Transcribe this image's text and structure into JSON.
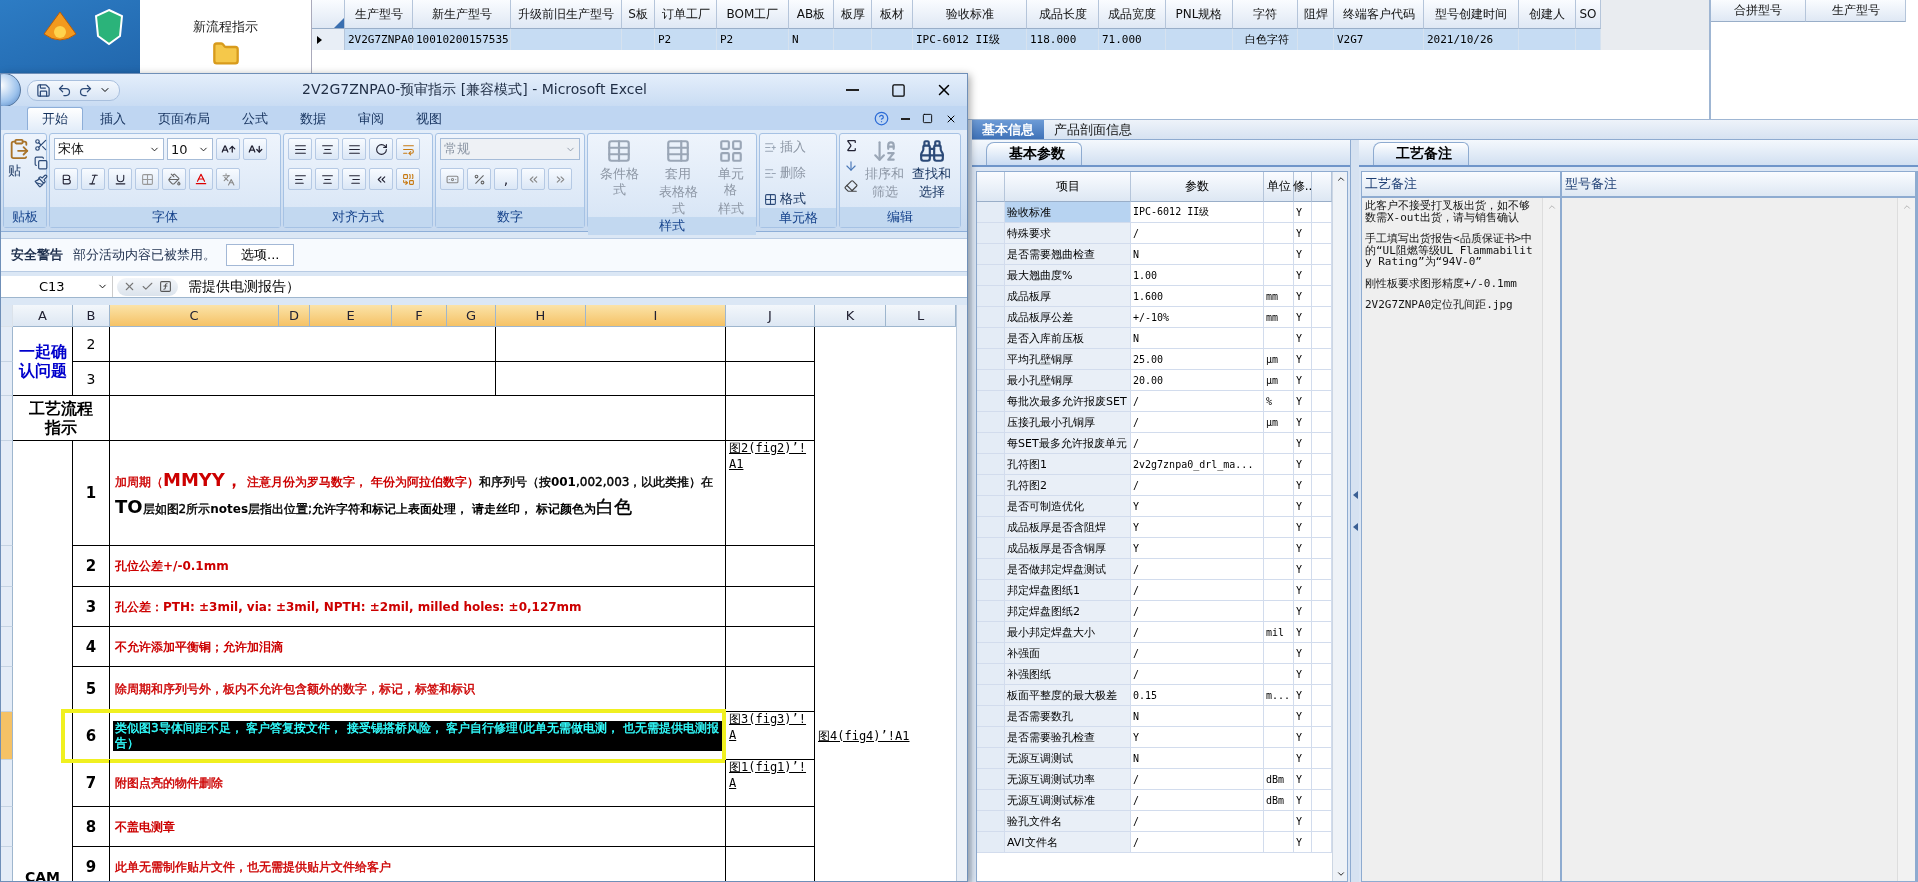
{
  "launcher": {
    "items": [
      {
        "label": "新流程指示"
      }
    ]
  },
  "order_grid": {
    "columns": [
      "生产型号",
      "新生产型号",
      "升级前旧生产型号",
      "S板",
      "订单工厂",
      "BOM工厂",
      "AB板",
      "板厚",
      "板材",
      "验收标准",
      "成品长度",
      "成品宽度",
      "PNL规格",
      "字符",
      "阻焊",
      "终端客户代码",
      "型号创建时间",
      "创建人",
      "SO"
    ],
    "rows": [
      {
        "selected": true,
        "cells": [
          "2V2G7ZNPA0",
          "10010200157535",
          "",
          "",
          "P2",
          "P2",
          "N",
          "",
          "",
          "IPC-6012 II级",
          "118.000",
          "71.000",
          "",
          "白色字符",
          "",
          "V2G7",
          "2021/10/26",
          "",
          ""
        ]
      }
    ]
  },
  "merge_grid": {
    "columns": [
      "合拼型号",
      "生产型号"
    ]
  },
  "info_tabs": [
    {
      "label": "基本信息",
      "selected": true
    },
    {
      "label": "产品剖面信息",
      "selected": false
    }
  ],
  "params": {
    "tab": "基本参数",
    "columns": [
      "项目",
      "参数",
      "单位",
      "修.."
    ],
    "rows": [
      {
        "item": "验收标准",
        "value": "IPC-6012 II级",
        "flag": "Y",
        "selected": true
      },
      {
        "item": "特殊要求",
        "value": "/",
        "flag": "Y",
        "selected": false
      },
      {
        "item": "是否需要翘曲检查",
        "value": "N",
        "flag": "Y",
        "selected": false
      },
      {
        "item": "最大翘曲度%",
        "value": "1.00",
        "flag": "Y",
        "selected": false
      },
      {
        "item": "成品板厚",
        "value": "1.600",
        "unit": "mm",
        "flag": "Y",
        "selected": false
      },
      {
        "item": "成品板厚公差",
        "value": "+/-10%",
        "unit": "mm",
        "flag": "Y",
        "selected": false
      },
      {
        "item": "是否入库前压板",
        "value": "N",
        "flag": "Y",
        "selected": false
      },
      {
        "item": "平均孔壁铜厚",
        "value": "25.00",
        "unit": "μm",
        "flag": "Y",
        "selected": false
      },
      {
        "item": "最小孔壁铜厚",
        "value": "20.00",
        "unit": "μm",
        "flag": "Y",
        "selected": false
      },
      {
        "item": "每批次最多允许报废SET",
        "value": "/",
        "unit": "%",
        "flag": "Y",
        "selected": false
      },
      {
        "item": "压接孔最小孔铜厚",
        "value": "/",
        "unit": "μm",
        "flag": "Y",
        "selected": false
      },
      {
        "item": "每SET最多允许报废单元",
        "value": "/",
        "flag": "Y",
        "selected": false
      },
      {
        "item": "孔符图1",
        "value": "2v2g7znpa0_drl_ma...",
        "flag": "Y",
        "selected": false
      },
      {
        "item": "孔符图2",
        "value": "/",
        "flag": "Y",
        "selected": false
      },
      {
        "item": "是否可制造优化",
        "value": "Y",
        "flag": "Y",
        "selected": false
      },
      {
        "item": "成品板厚是否含阻焊",
        "value": "Y",
        "flag": "Y",
        "selected": false
      },
      {
        "item": "成品板厚是否含铜厚",
        "value": "Y",
        "flag": "Y",
        "selected": false
      },
      {
        "item": "是否做邦定焊盘测试",
        "value": "/",
        "flag": "Y",
        "selected": false
      },
      {
        "item": "邦定焊盘图纸1",
        "value": "/",
        "flag": "Y",
        "selected": false
      },
      {
        "item": "邦定焊盘图纸2",
        "value": "/",
        "flag": "Y",
        "selected": false
      },
      {
        "item": "最小邦定焊盘大小",
        "value": "/",
        "unit": "mil",
        "flag": "Y",
        "selected": false
      },
      {
        "item": "补强面",
        "value": "/",
        "flag": "Y",
        "selected": false
      },
      {
        "item": "补强图纸",
        "value": "/",
        "flag": "Y",
        "selected": false
      },
      {
        "item": "板面平整度的最大极差",
        "value": "0.15",
        "unit": "m...",
        "flag": "Y",
        "selected": false
      },
      {
        "item": "是否需要数孔",
        "value": "N",
        "flag": "Y",
        "selected": false
      },
      {
        "item": "是否需要验孔检查",
        "value": "Y",
        "flag": "Y",
        "selected": false
      },
      {
        "item": "无源互调测试",
        "value": "N",
        "flag": "Y",
        "selected": false
      },
      {
        "item": "无源互调测试功率",
        "value": "/",
        "unit": "dBm",
        "flag": "Y",
        "selected": false
      },
      {
        "item": "无源互调测试标准",
        "value": "/",
        "unit": "dBm",
        "flag": "Y",
        "selected": false
      },
      {
        "item": "验孔文件名",
        "value": "/",
        "flag": "Y",
        "selected": false
      },
      {
        "item": "AVI文件名",
        "value": "/",
        "flag": "Y",
        "selected": false
      }
    ]
  },
  "notes": {
    "tab": "工艺备注",
    "columns": [
      "工艺备注",
      "型号备注"
    ],
    "process_notes": [
      "此客户不接受打叉板出货，如不够数需X-out出货，请与销售确认",
      "手工填写出货报告<品质保证书>中的“UL阻燃等级UL Flammability Rating”为“94V-0”",
      "刚性板要求图形精度+/-0.1mm",
      "2V2G7ZNPA0定位孔间距.jpg"
    ]
  },
  "excel": {
    "title": "2V2G7ZNPA0-预审指示  [兼容模式] - Microsoft Excel",
    "ribbon_tabs": [
      {
        "label": "开始",
        "selected": true
      },
      {
        "label": "插入",
        "selected": false
      },
      {
        "label": "页面布局",
        "selected": false
      },
      {
        "label": "公式",
        "selected": false
      },
      {
        "label": "数据",
        "selected": false
      },
      {
        "label": "审阅",
        "selected": false
      },
      {
        "label": "视图",
        "selected": false
      }
    ],
    "ribbon": {
      "paste_label": "贴",
      "font_name": "宋体",
      "font_size": "10",
      "number_format": {
        "value": "常规",
        "disabled": true
      },
      "comma_label": ",",
      "style_buttons": [
        {
          "lines": [
            "条件格式"
          ],
          "disabled": true
        },
        {
          "lines": [
            "套用",
            "表格格式"
          ],
          "disabled": true
        },
        {
          "lines": [
            "单元格",
            "样式"
          ],
          "disabled": true
        }
      ],
      "cell_buttons": [
        {
          "label": "插入",
          "disabled": true
        },
        {
          "label": "删除",
          "disabled": true
        },
        {
          "label": "格式",
          "disabled": false
        }
      ],
      "edit_buttons": [
        {
          "lines": [
            "排序和",
            "筛选"
          ],
          "disabled": true
        },
        {
          "lines": [
            "查找和",
            "选择"
          ],
          "disabled": false
        }
      ],
      "groups": [
        "贴板",
        "字体",
        "对齐方式",
        "数字",
        "样式",
        "单元格",
        "编辑"
      ]
    },
    "security": {
      "title": "安全警告",
      "message": "部分活动内容已被禁用。",
      "button": "选项..."
    },
    "formula_bar": {
      "cell": "C13",
      "content": "需提供电测报告）"
    },
    "sheet": {
      "columns": [
        {
          "label": "A",
          "selected": false
        },
        {
          "label": "B",
          "selected": false
        },
        {
          "label": "C",
          "selected": true
        },
        {
          "label": "D",
          "selected": true
        },
        {
          "label": "E",
          "selected": true
        },
        {
          "label": "F",
          "selected": true
        },
        {
          "label": "G",
          "selected": true
        },
        {
          "label": "H",
          "selected": true
        },
        {
          "label": "I",
          "selected": true
        },
        {
          "label": "J",
          "selected": false
        },
        {
          "label": "K",
          "selected": false
        },
        {
          "label": "L",
          "selected": false
        }
      ],
      "question_label": "一起确认问题",
      "question_rows": [
        "2",
        "3"
      ],
      "process_label": "工艺流程指示",
      "cam_label": "CAM",
      "items": [
        {
          "number": "1",
          "selected": false,
          "link": "图2(fig2)’!A1",
          "segments": [
            {
              "text": "加周期（",
              "color": "#cc0000",
              "bold": false
            },
            {
              "text": "MMYY，",
              "color": "#cc0000",
              "bold": true,
              "large": true
            },
            {
              "text": "  注意",
              "color": "#cc0000",
              "bold": false
            },
            {
              "text": "月份",
              "color": "#cc0000",
              "bold": true
            },
            {
              "text": "为",
              "color": "#cc0000",
              "bold": false
            },
            {
              "text": "罗马数字，",
              "color": "#cc0000",
              "bold": true
            },
            {
              "text": "  年份",
              "color": "#cc0000",
              "bold": true
            },
            {
              "text": "为",
              "color": "#cc0000",
              "bold": false
            },
            {
              "text": "阿拉伯数字）",
              "color": "#cc0000",
              "bold": true
            },
            {
              "text": "和序列号（按",
              "color": "#000000",
              "bold": false
            },
            {
              "text": "001",
              "color": "#000000",
              "bold": true
            },
            {
              "text": ",002,003，以此类推）在",
              "color": "#000000",
              "bold": false
            },
            {
              "text": "TO",
              "color": "#000000",
              "bold": true,
              "large": true
            },
            {
              "text": "层如图2所示",
              "color": "#000000",
              "bold": false
            },
            {
              "text": "notes",
              "color": "#000000",
              "bold": true
            },
            {
              "text": "层指出位置;",
              "color": "#000000",
              "bold": false
            },
            {
              "text": "允许字符和标记上表面处理，  请走丝印，  标记颜色为",
              "color": "#000000",
              "bold": true
            },
            {
              "text": "白色",
              "color": "#000000",
              "bold": false,
              "large": true
            }
          ]
        },
        {
          "number": "2",
          "selected": false,
          "segments": [
            {
              "text": "孔位公差+/-0.1mm",
              "color": "#cc0000",
              "bold": true
            }
          ]
        },
        {
          "number": "3",
          "selected": false,
          "segments": [
            {
              "text": "孔公差：PTH: ±3mil, via: ±3mil, NPTH: ±2mil, milled holes: ±0,127mm",
              "color": "#cc0000",
              "bold": true
            }
          ]
        },
        {
          "number": "4",
          "selected": false,
          "segments": [
            {
              "text": "不允许添加平衡铜；允许加泪滴",
              "color": "#cc0000",
              "bold": true
            }
          ]
        },
        {
          "number": "5",
          "selected": false,
          "segments": [
            {
              "text": "除周期和序列号外，板内不允许包含额外的数字，标记，标签和标识",
              "color": "#cc0000",
              "bold": false
            }
          ]
        },
        {
          "number": "6",
          "selected": true,
          "link": "图3(fig3)’!A",
          "extra_link": "图4(fig4)’!A1",
          "segments": [
            {
              "text": "类似图3导体间距不足，  客户答复",
              "bold": false
            },
            {
              "text": "按文件，  接受",
              "bold": true
            },
            {
              "text": "锡搭桥风险，   客户自行修理(此单",
              "bold": false
            },
            {
              "text": "无需做电测，",
              "bold": true
            },
            {
              "text": "  也无需提供电测报告）",
              "bold": false
            }
          ]
        },
        {
          "number": "7",
          "selected": false,
          "link": "图1(fig1)’!A",
          "segments": [
            {
              "text": "附图点亮的物件删除",
              "color": "#cc0000",
              "bold": false
            }
          ]
        },
        {
          "number": "8",
          "selected": false,
          "segments": [
            {
              "text": "不盖电测章",
              "color": "#cc0000",
              "bold": true
            }
          ]
        },
        {
          "number": "9",
          "selected": false,
          "segments": [
            {
              "text": "此单无需制作贴片文件，也无需提供贴片文件给客户",
              "color": "#cc0000",
              "bold": false
            }
          ]
        }
      ]
    }
  }
}
